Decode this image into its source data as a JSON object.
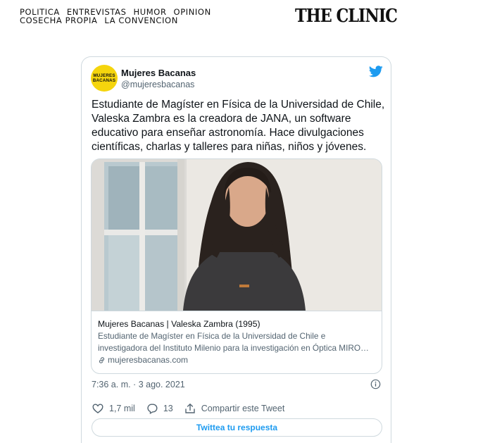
{
  "site": {
    "nav_row1": [
      "POLITICA",
      "ENTREVISTAS",
      "HUMOR",
      "OPINION"
    ],
    "nav_row2": [
      "COSECHA PROPIA",
      "LA CONVENCION"
    ],
    "logo": "THE CLINIC"
  },
  "tweet": {
    "avatar_line1": "MUJERES",
    "avatar_line2": "BACANAS",
    "author_name": "Mujeres Bacanas",
    "author_handle": "@mujeresbacanas",
    "text": "Estudiante de Magíster en Física de la Universidad de Chile, Valeska Zambra es la creadora de JANA, un software educativo para enseñar astronomía. Hace divulgaciones científicas, charlas y talleres para niñas, niños y jóvenes.",
    "link_card": {
      "title": "Mujeres Bacanas | Valeska Zambra (1995)",
      "description_line1": "Estudiante de Magíster en Física de la Universidad de Chile e",
      "description_line2": "investigadora del Instituto Milenio para la investigación en Óptica MIRO…",
      "domain": "mujeresbacanas.com"
    },
    "timestamp": "7:36 a. m. · 3 ago. 2021",
    "likes": "1,7 mil",
    "replies": "13",
    "share_label": "Compartir este Tweet",
    "reply_label": "Twittea tu respuesta"
  },
  "colors": {
    "accent": "#1d9bf0",
    "avatar_bg": "#f5d50d",
    "secondary_text": "#536471",
    "border": "#cfd9de"
  }
}
